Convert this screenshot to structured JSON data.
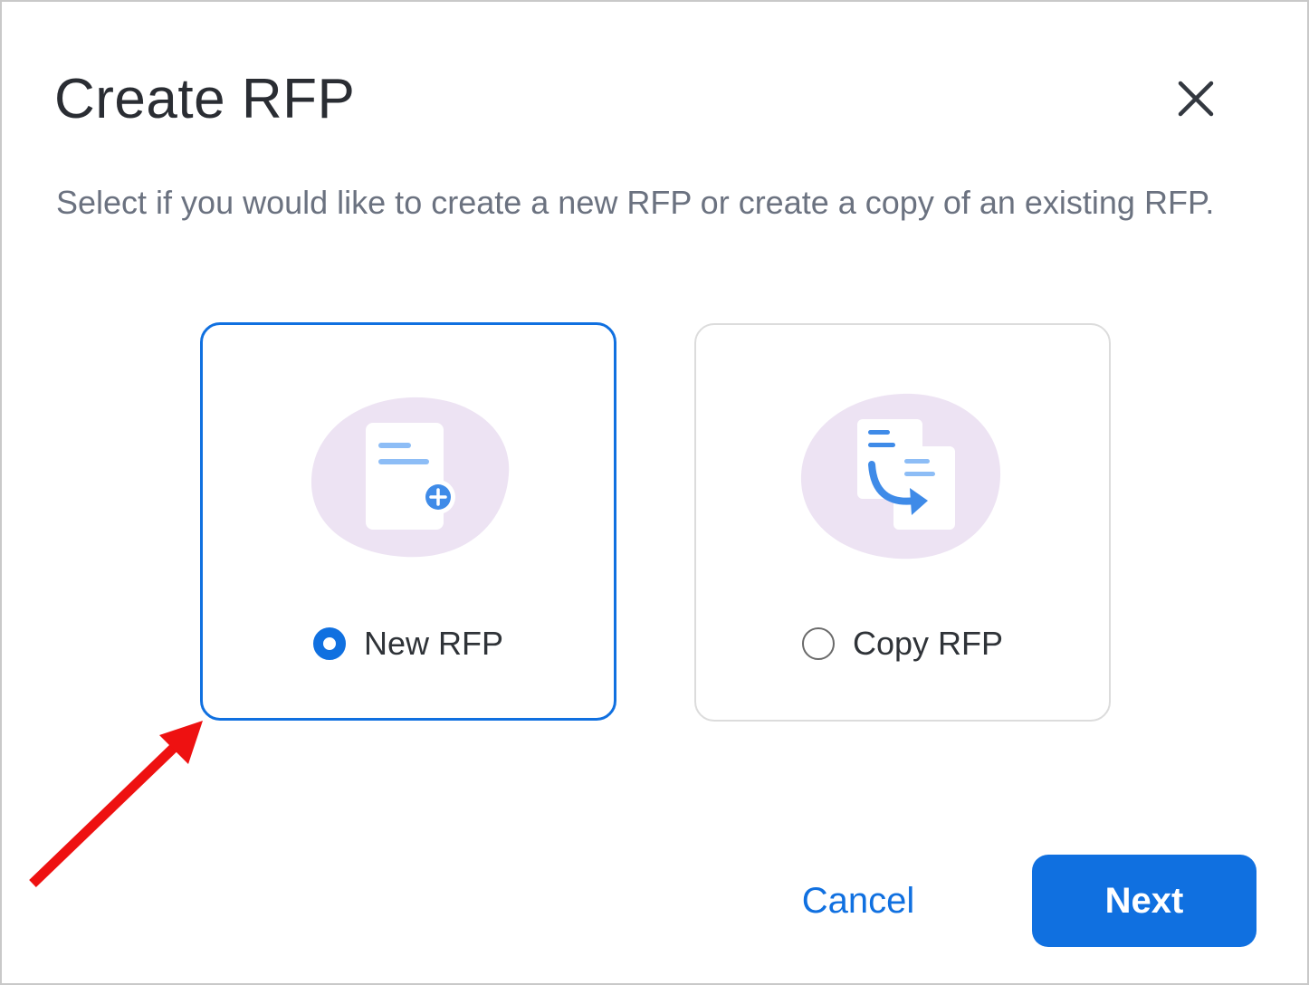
{
  "dialog": {
    "title": "Create RFP",
    "subtitle": "Select if you would like to create a new RFP or create a copy of an existing RFP.",
    "close_icon": "close-icon"
  },
  "options": [
    {
      "label": "New RFP",
      "selected": true,
      "icon": "new-document-plus-icon"
    },
    {
      "label": "Copy RFP",
      "selected": false,
      "icon": "copy-document-icon"
    }
  ],
  "actions": {
    "cancel_label": "Cancel",
    "next_label": "Next"
  },
  "colors": {
    "accent": "#1070e0",
    "illustration_bg": "#ede3f3",
    "annotation_arrow": "#ee1111"
  }
}
